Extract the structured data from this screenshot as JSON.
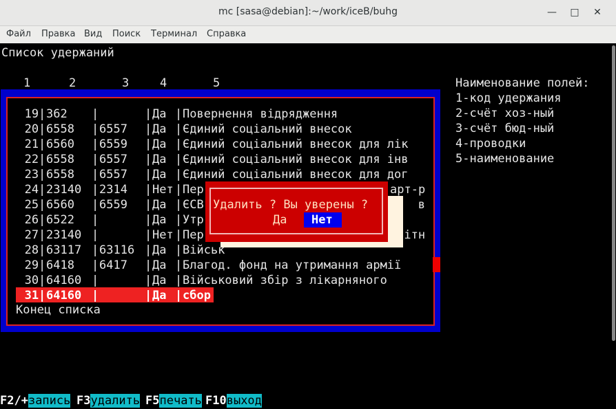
{
  "window": {
    "title": "mc [sasa@debian]:~/work/iceB/buhg",
    "menu": [
      "Файл",
      "Правка",
      "Вид",
      "Поиск",
      "Терминал",
      "Справка"
    ]
  },
  "screen": {
    "heading": "Список удержаний",
    "column_numbers": [
      "1",
      "2",
      "3",
      "4",
      "5"
    ],
    "fields_help": {
      "title": "Наименование полей:",
      "items": [
        "1-код удержания",
        "2-счёт хоз-ный",
        "3-счёт бюд-ный",
        "4-проводки",
        "5-наименование"
      ]
    },
    "rows": [
      {
        "code": "19",
        "acc1": "362",
        "acc2": "",
        "post": "Да",
        "name": "Повернення відрядження"
      },
      {
        "code": "20",
        "acc1": "6558",
        "acc2": "6557",
        "post": "Да",
        "name": "Єдиний соціальний внесок"
      },
      {
        "code": "21",
        "acc1": "6560",
        "acc2": "6559",
        "post": "Да",
        "name": "Єдиний соціальний внесок для лік"
      },
      {
        "code": "22",
        "acc1": "6558",
        "acc2": "6557",
        "post": "Да",
        "name": "Єдиний соціальний внесок для інв"
      },
      {
        "code": "23",
        "acc1": "6558",
        "acc2": "6557",
        "post": "Да",
        "name": "Єдиний соціальний внесок для дог"
      },
      {
        "code": "24",
        "acc1": "23140",
        "acc2": "2314",
        "post": "Нет",
        "name": "Пер",
        "tail": "арт-р"
      },
      {
        "code": "25",
        "acc1": "6560",
        "acc2": "6559",
        "post": "Да",
        "name": "ЄСВ",
        "tail": "в"
      },
      {
        "code": "26",
        "acc1": "6522",
        "acc2": "",
        "post": "Да",
        "name": "Утр",
        "tail": ""
      },
      {
        "code": "27",
        "acc1": "23140",
        "acc2": "",
        "post": "Нет",
        "name": "Пер",
        "tail": "ітн"
      },
      {
        "code": "28",
        "acc1": "63117",
        "acc2": "63116",
        "post": "Да",
        "name": "Військ",
        "tail": ""
      },
      {
        "code": "29",
        "acc1": "6418",
        "acc2": "6417",
        "post": "Да",
        "name": "Благод. фонд на утримання армії"
      },
      {
        "code": "30",
        "acc1": "64160",
        "acc2": "",
        "post": "Да",
        "name": "Військовий збір з лікарняного"
      },
      {
        "code": "31",
        "acc1": "64160",
        "acc2": "",
        "post": "Да",
        "name": "сбор"
      }
    ],
    "end_of_list": "Конец списка"
  },
  "dialog": {
    "question": "Удалить ? Вы уверены ?",
    "yes_label": "Да",
    "no_label": "Нет"
  },
  "function_keys": [
    {
      "key": "F2/+",
      "label": "запись"
    },
    {
      "key": "F3",
      "label": "удалить"
    },
    {
      "key": "F5",
      "label": "печать"
    },
    {
      "key": "F10",
      "label": "выход"
    }
  ],
  "colors": {
    "frame_blue": "#0000cc",
    "frame_red": "#dd2222",
    "selected_row": "#ee2222",
    "dialog_bg": "#cc0000",
    "no_button_bg": "#0000ee",
    "fkey_label_bg": "#11bbc8"
  }
}
